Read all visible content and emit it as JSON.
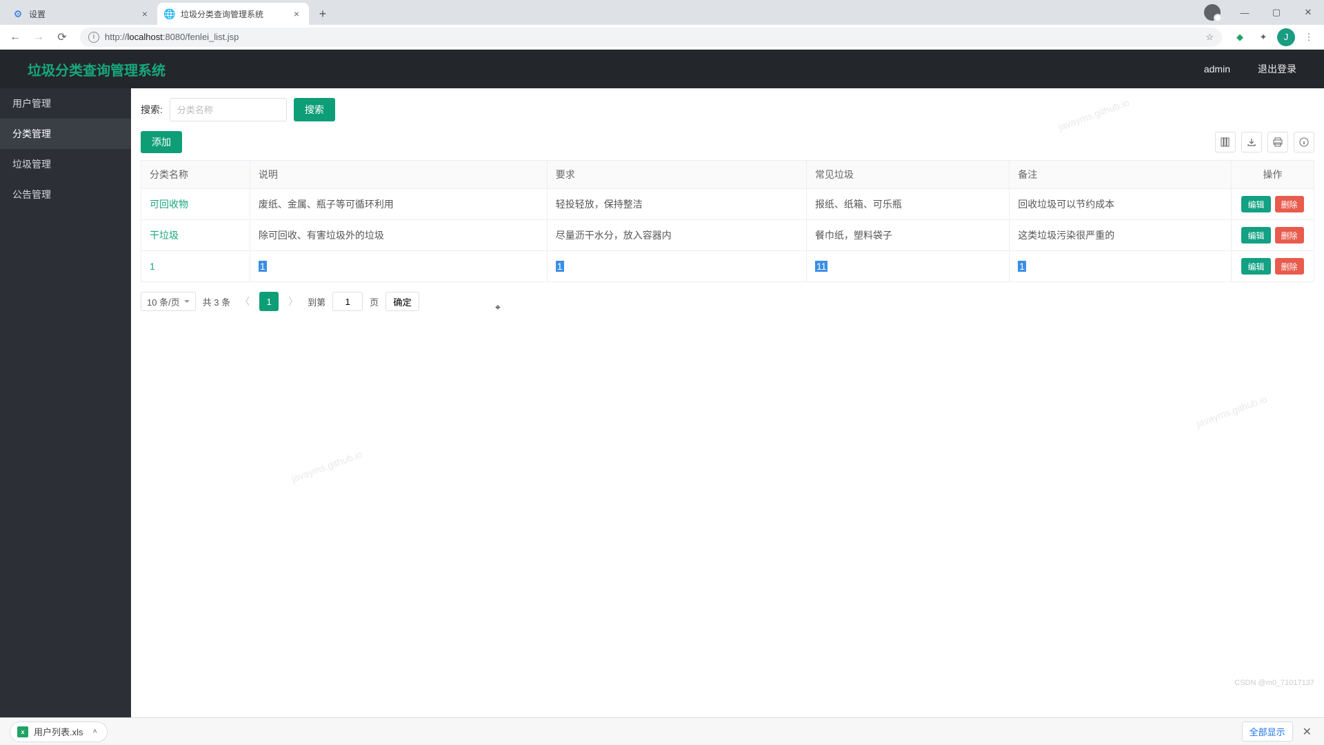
{
  "browser": {
    "tabs": [
      {
        "title": "设置",
        "favicon": "gear"
      },
      {
        "title": "垃圾分类查询管理系统",
        "favicon": "globe"
      }
    ],
    "url_host": "localhost",
    "url_prefix": "http://",
    "url_port_path": ":8080/fenlei_list.jsp",
    "avatar_letter": "J"
  },
  "header": {
    "title": "垃圾分类查询管理系统",
    "user": "admin",
    "logout": "退出登录"
  },
  "sidebar": {
    "items": [
      "用户管理",
      "分类管理",
      "垃圾管理",
      "公告管理"
    ],
    "active_index": 1
  },
  "search": {
    "label": "搜索:",
    "placeholder": "分类名称",
    "button": "搜索"
  },
  "toolbar": {
    "add": "添加"
  },
  "columns": [
    "分类名称",
    "说明",
    "要求",
    "常见垃圾",
    "备注",
    "操作"
  ],
  "rows": [
    {
      "name": "可回收物",
      "desc": "废纸、金属、瓶子等可循环利用",
      "req": "轻投轻放，保持整洁",
      "common": "报纸、纸箱、可乐瓶",
      "note": "回收垃圾可以节约成本",
      "link": true,
      "hl": false
    },
    {
      "name": "干垃圾",
      "desc": "除可回收、有害垃圾外的垃圾",
      "req": "尽量沥干水分，放入容器内",
      "common": "餐巾纸，塑料袋子",
      "note": "这类垃圾污染很严重的",
      "link": true,
      "hl": false
    },
    {
      "name": "1",
      "desc": "1",
      "req": "1",
      "common": "11",
      "note": "1",
      "link": true,
      "hl": true
    }
  ],
  "actions": {
    "edit": "编辑",
    "delete": "删除"
  },
  "pager": {
    "size": "10 条/页",
    "total": "共 3 条",
    "current": "1",
    "goto_prefix": "到第",
    "goto_value": "1",
    "goto_suffix": "页",
    "confirm": "确定"
  },
  "download": {
    "file": "用户列表.xls",
    "show_all": "全部显示"
  },
  "watermarks": [
    "javayms.github.io",
    "javayms.github.io",
    "javayms.github.io"
  ],
  "csdn": "CSDN @m0_71017137"
}
